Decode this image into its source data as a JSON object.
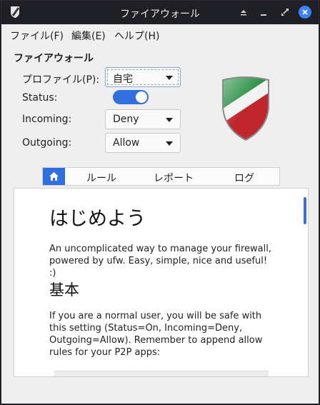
{
  "window": {
    "title": "ファイアウォール"
  },
  "menubar": {
    "items": [
      "ファイル(F)",
      "編集(E)",
      "ヘルプ(H)"
    ]
  },
  "firewall": {
    "section_title": "ファイアウォール",
    "profile": {
      "label": "プロファイル(P):",
      "value": "自宅"
    },
    "status": {
      "label": "Status:",
      "enabled": true
    },
    "incoming": {
      "label": "Incoming:",
      "value": "Deny"
    },
    "outgoing": {
      "label": "Outgoing:",
      "value": "Allow"
    }
  },
  "tabs": {
    "items": [
      "ルール",
      "レポート",
      "ログ"
    ]
  },
  "content": {
    "heading": "はじめよう",
    "intro": "An uncomplicated way to manage your firewall, powered by ufw. Easy, simple, nice and useful! :)",
    "subheading": "基本",
    "basic": "If you are a normal user, you will be safe with this setting (Status=On, Incoming=Deny, Outgoing=Allow). Remember to append allow rules for your P2P apps:"
  },
  "colors": {
    "accent": "#2f6fe0",
    "titlebar": "#1f1f26"
  }
}
